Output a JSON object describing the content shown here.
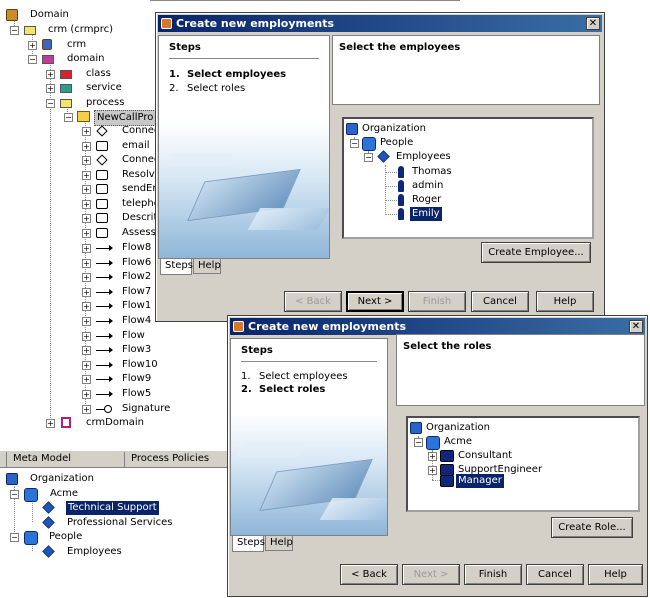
{
  "background_tree": {
    "root": "Domain",
    "nodes": {
      "crm_crmprc": "crm (crmprc)",
      "crm": "crm",
      "domain": "domain",
      "class": "class",
      "service": "service",
      "process": "process",
      "newcallprocess": "NewCallPro",
      "connect1": "Connec",
      "email": "email",
      "connect2": "Connec",
      "resolve": "Resolv",
      "sendemail": "sendEr",
      "telephone": "telepho",
      "describe": "Descrit",
      "assess": "Assess",
      "flow8": "Flow8",
      "flow6": "Flow6",
      "flow2": "Flow2",
      "flow7": "Flow7",
      "flow1": "Flow1",
      "flow4": "Flow4",
      "flow": "Flow",
      "flow3": "Flow3",
      "flow10": "Flow10",
      "flow9": "Flow9",
      "flow5": "Flow5",
      "signature": "Signature",
      "crmdomain": "crmDomain"
    }
  },
  "bottom_panel": {
    "tabs": [
      "Meta Model",
      "Process Policies"
    ],
    "tree": {
      "organization": "Organization",
      "acme": "Acme",
      "technical_support": "Technical Support",
      "professional_services": "Professional Services",
      "people": "People",
      "employees": "Employees"
    }
  },
  "dialog1": {
    "title": "Create new employments",
    "steps_title": "Steps",
    "steps": [
      {
        "num": "1.",
        "label": "Select employees"
      },
      {
        "num": "2.",
        "label": "Select roles"
      }
    ],
    "tabs": [
      "Steps",
      "Help"
    ],
    "header": "Select the employees",
    "tree": {
      "organization": "Organization",
      "people": "People",
      "employees": "Employees",
      "thomas": "Thomas",
      "admin": "admin",
      "roger": "Roger",
      "emily": "Emily"
    },
    "create_button": "Create Employee...",
    "buttons": {
      "back": "< Back",
      "next": "Next >",
      "finish": "Finish",
      "cancel": "Cancel",
      "help": "Help"
    }
  },
  "dialog2": {
    "title": "Create new employments",
    "steps_title": "Steps",
    "steps": [
      {
        "num": "1.",
        "label": "Select employees"
      },
      {
        "num": "2.",
        "label": "Select roles"
      }
    ],
    "tabs": [
      "Steps",
      "Help"
    ],
    "header": "Select the roles",
    "tree": {
      "organization": "Organization",
      "acme": "Acme",
      "consultant": "Consultant",
      "supportengineer": "SupportEngineer",
      "manager": "Manager"
    },
    "create_button": "Create Role...",
    "buttons": {
      "back": "< Back",
      "next": "Next >",
      "finish": "Finish",
      "cancel": "Cancel",
      "help": "Help"
    }
  }
}
